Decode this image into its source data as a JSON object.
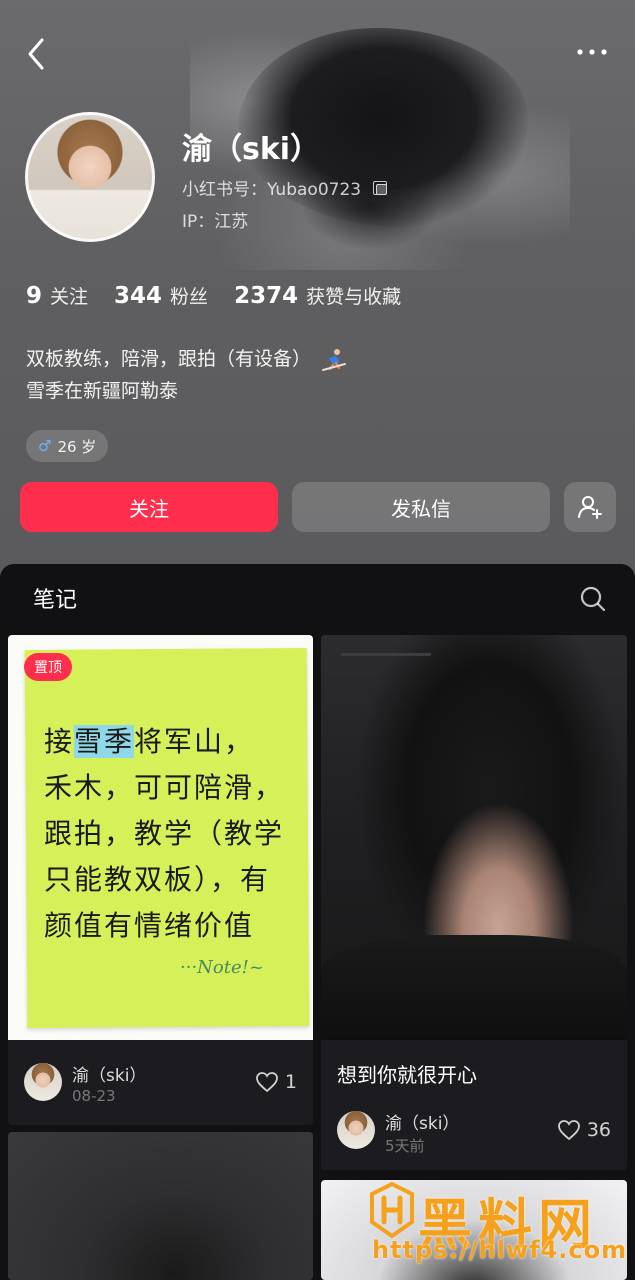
{
  "profile": {
    "name": "渝（ski）",
    "red_id": "小红书号：Yubao0723",
    "ip": "IP：江苏",
    "stats": [
      {
        "num": "9",
        "label": "关注"
      },
      {
        "num": "344",
        "label": "粉丝"
      },
      {
        "num": "2374",
        "label": "获赞与收藏"
      }
    ],
    "bio_line1": "双板教练，陪滑，跟拍（有设备）",
    "bio_line2": "雪季在新疆阿勒泰",
    "age_tag": "26 岁",
    "gender_symbol": "♂"
  },
  "actions": {
    "follow": "关注",
    "message": "发私信"
  },
  "notes": {
    "title": "笔记",
    "cards": [
      {
        "badge": "置顶",
        "cover_lines": [
          "接雪季将军山，",
          "禾木，可可陪滑，",
          "跟拍，教学（教学",
          "只能教双板），有",
          "颜值有情绪价值"
        ],
        "cover_highlight": "雪季",
        "cover_note": "···Note!~",
        "author": "渝（ski）",
        "date": "08-23",
        "likes": "1"
      },
      {
        "title": "想到你就很开心",
        "author": "渝（ski）",
        "date": "5天前",
        "likes": "36"
      }
    ]
  },
  "watermark": {
    "title": "黑料网",
    "url": "https://hlwf4.com"
  },
  "colors": {
    "accent": "#ff2e4d",
    "sticky_note": "#d6f05a",
    "watermark": "#f5a11c"
  }
}
